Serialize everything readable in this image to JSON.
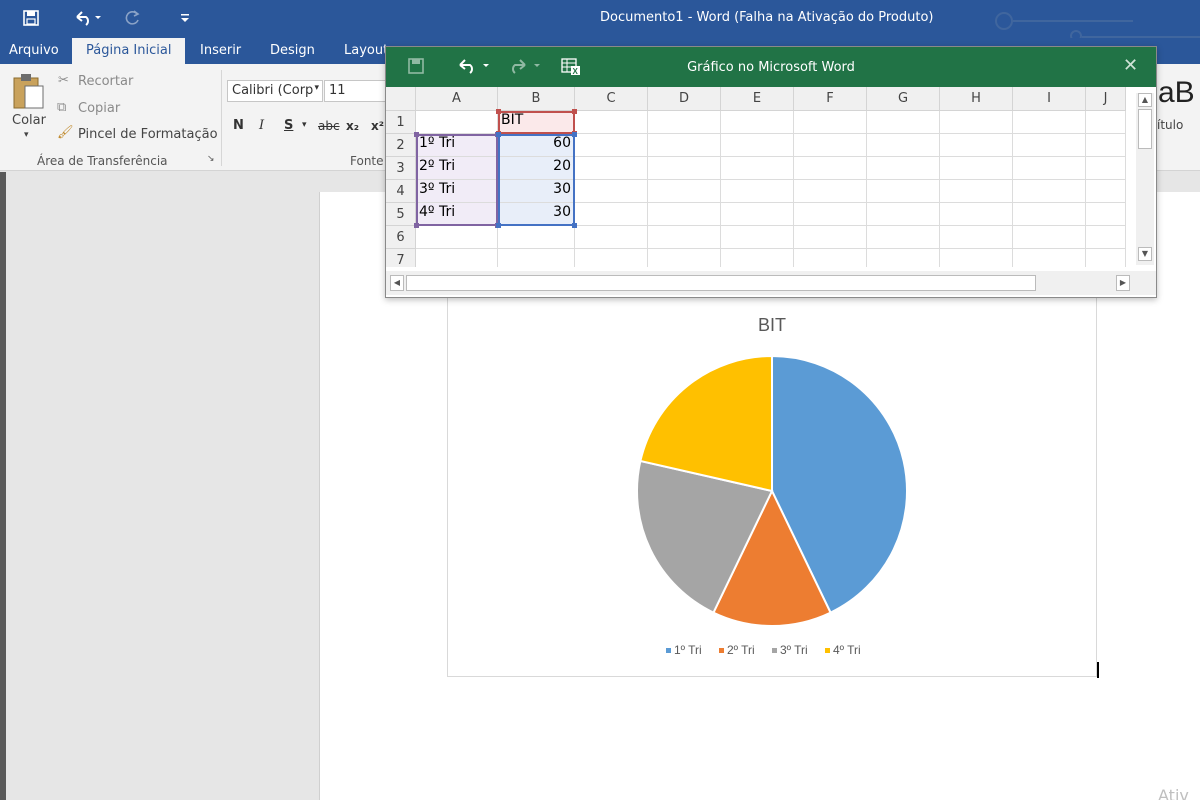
{
  "word": {
    "document_title": "Documento1 - Word (Falha na Ativação do Produto)",
    "tabs": [
      "Arquivo",
      "Página Inicial",
      "Inserir",
      "Design",
      "Layout"
    ],
    "active_tab": "Página Inicial",
    "clipboard": {
      "paste_label": "Colar",
      "cut_label": "Recortar",
      "copy_label": "Copiar",
      "format_painter_label": "Pincel de Formatação",
      "group_label": "Área de Transferência"
    },
    "font": {
      "font_name": "Calibri (Corp",
      "font_size": "11",
      "group_label": "Fonte",
      "bold": "N",
      "italic": "I",
      "underline": "S",
      "strike": "abc",
      "subscript": "x₂",
      "superscript": "x²"
    },
    "styles_preview": "aB",
    "styles_caption": "ítulo",
    "bottom_right_text": "Ativ"
  },
  "excel_popup": {
    "title": "Gráfico no Microsoft Word",
    "columns": [
      "A",
      "B",
      "C",
      "D",
      "E",
      "F",
      "G",
      "H",
      "I",
      "J"
    ],
    "rows": [
      "1",
      "2",
      "3",
      "4",
      "5",
      "6",
      "7"
    ],
    "cells": {
      "B1": "BIT",
      "A2": "1º Tri",
      "B2": "60",
      "A3": "2º Tri",
      "B3": "20",
      "A4": "3º Tri",
      "B4": "30",
      "A5": "4º Tri",
      "B5": "30"
    }
  },
  "chart_data": {
    "type": "pie",
    "title": "BIT",
    "categories": [
      "1º Tri",
      "2º Tri",
      "3º Tri",
      "4º Tri"
    ],
    "values": [
      60,
      20,
      30,
      30
    ],
    "colors": [
      "#5b9bd5",
      "#ed7d31",
      "#a5a5a5",
      "#ffc000"
    ],
    "legend": "bottom"
  }
}
